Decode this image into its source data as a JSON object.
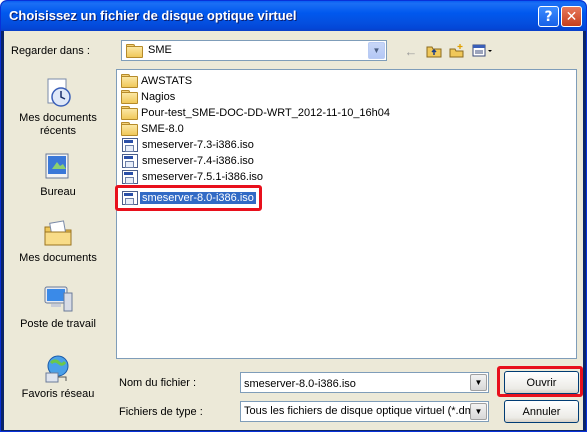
{
  "window": {
    "title": "Choisissez un fichier de disque optique virtuel",
    "help_glyph": "?",
    "close_glyph": "✕"
  },
  "lookin": {
    "label": "Regarder dans :",
    "value": "SME",
    "dropdown_glyph": "▼"
  },
  "toolbar": {
    "back_icon": "←",
    "up_icon": "up-folder-icon",
    "newfolder_icon": "new-folder-icon",
    "views_icon": "views-menu-icon"
  },
  "places": [
    {
      "label": "Mes documents récents",
      "icon": "recent-documents-icon"
    },
    {
      "label": "Bureau",
      "icon": "desktop-icon"
    },
    {
      "label": "Mes documents",
      "icon": "my-documents-icon"
    },
    {
      "label": "Poste de travail",
      "icon": "my-computer-icon"
    },
    {
      "label": "Favoris réseau",
      "icon": "network-places-icon"
    }
  ],
  "files": [
    {
      "name": "AWSTATS",
      "type": "folder"
    },
    {
      "name": "Nagios",
      "type": "folder"
    },
    {
      "name": "Pour-test_SME-DOC-DD-WRT_2012-11-10_16h04",
      "type": "folder"
    },
    {
      "name": "SME-8.0",
      "type": "folder"
    },
    {
      "name": "smeserver-7.3-i386.iso",
      "type": "iso"
    },
    {
      "name": "smeserver-7.4-i386.iso",
      "type": "iso"
    },
    {
      "name": "smeserver-7.5.1-i386.iso",
      "type": "iso"
    },
    {
      "name": "smeserver-8.0-i386.iso",
      "type": "iso",
      "selected": true
    }
  ],
  "filename": {
    "label": "Nom du fichier :",
    "value": "smeserver-8.0-i386.iso"
  },
  "filetype": {
    "label": "Fichiers de type :",
    "value": "Tous les fichiers de disque optique virtuel (*.dm"
  },
  "buttons": {
    "open": "Ouvrir",
    "cancel": "Annuler"
  },
  "colors": {
    "titlebar": "#0058ee",
    "selection": "#316ac5",
    "highlight_box": "#e8101c",
    "dialog_bg": "#ece9d8"
  }
}
